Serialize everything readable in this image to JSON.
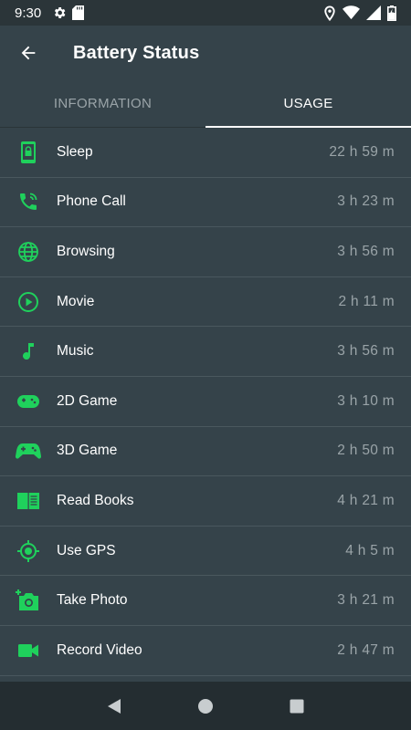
{
  "status_bar": {
    "time": "9:30"
  },
  "app_bar": {
    "title": "Battery Status"
  },
  "tabs": [
    {
      "label": "INFORMATION",
      "active": false
    },
    {
      "label": "USAGE",
      "active": true
    }
  ],
  "colors": {
    "accent": "#1fd15c",
    "background": "#35434a",
    "divider": "#4a585e"
  },
  "usage": [
    {
      "icon": "phone-sleep-icon",
      "label": "Sleep",
      "value": "22 h 59 m"
    },
    {
      "icon": "phone-call-icon",
      "label": "Phone Call",
      "value": "3 h 23 m"
    },
    {
      "icon": "globe-icon",
      "label": "Browsing",
      "value": "3 h 56 m"
    },
    {
      "icon": "play-circle-icon",
      "label": "Movie",
      "value": "2 h 11 m"
    },
    {
      "icon": "music-note-icon",
      "label": "Music",
      "value": "3 h 56 m"
    },
    {
      "icon": "gamepad-icon",
      "label": "2D Game",
      "value": "3 h 10 m"
    },
    {
      "icon": "game-controller-icon",
      "label": "3D Game",
      "value": "2 h 50 m"
    },
    {
      "icon": "book-icon",
      "label": "Read Books",
      "value": "4 h 21 m"
    },
    {
      "icon": "gps-icon",
      "label": "Use GPS",
      "value": "4 h 5 m"
    },
    {
      "icon": "camera-add-icon",
      "label": "Take Photo",
      "value": "3 h 21 m"
    },
    {
      "icon": "video-camera-icon",
      "label": "Record Video",
      "value": "2 h 47 m"
    }
  ]
}
